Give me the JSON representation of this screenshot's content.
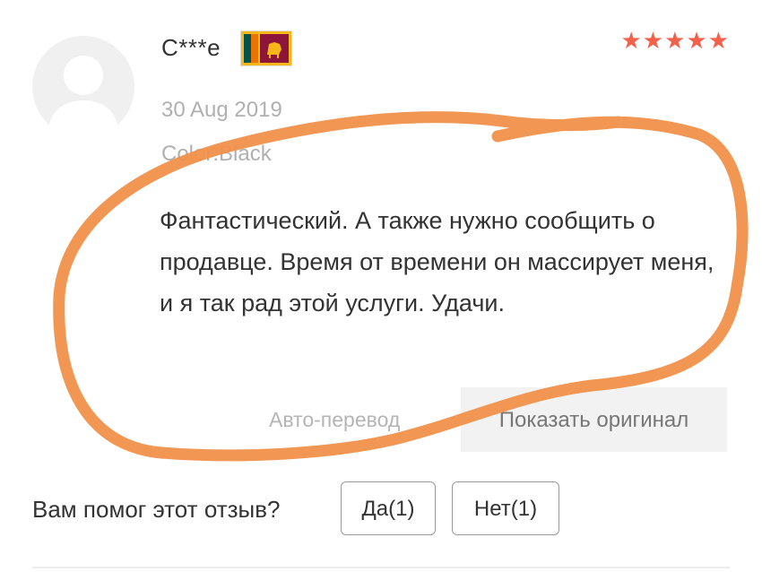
{
  "review": {
    "username": "C***e",
    "country_flag": "sri-lanka-flag",
    "rating": 5,
    "stars": "★★★★★",
    "date": "30 Aug 2019",
    "color_label": "Color:Black",
    "text": "Фантастический. А также нужно сообщить о продавце. Время от времени он массирует меня, и я так рад этой услуги. Удачи.",
    "auto_translate_label": "Авто-перевод",
    "show_original_label": "Показать оригинал"
  },
  "helpful": {
    "question": "Вам помог этот отзыв?",
    "yes_label": "Да(1)",
    "no_label": "Нет(1)"
  },
  "colors": {
    "stars": "#f4604a",
    "annotation_stroke": "#f0904a",
    "muted_text": "#b0b0b0"
  }
}
